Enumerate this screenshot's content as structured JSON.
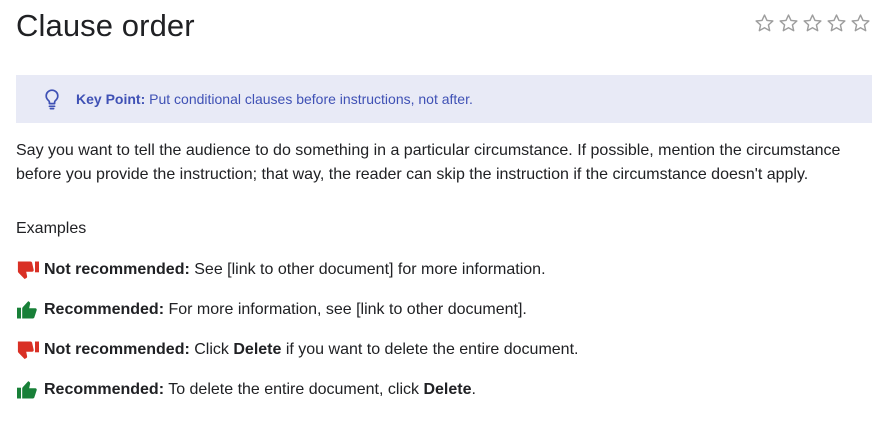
{
  "page": {
    "title": "Clause order"
  },
  "rating": {
    "stars": 5,
    "selected": 0,
    "star_icon": "star-outline-icon",
    "color": "#9e9e9e"
  },
  "callout": {
    "icon": "lightbulb-icon",
    "label": "Key Point:",
    "text": " Put conditional clauses before instructions, not after.",
    "background": "#e8eaf6",
    "text_color": "#3f51b5"
  },
  "body": {
    "paragraph": "Say you want to tell the audience to do something in a particular circumstance. If possible, mention the circumstance before you provide the instruction; that way, the reader can skip the instruction if the circumstance doesn't apply."
  },
  "examples": {
    "heading": "Examples",
    "items": [
      {
        "kind": "not-recommended",
        "icon": "thumbs-down-icon",
        "icon_color": "#d93025",
        "label": "Not recommended:",
        "text_before": " See [link to other document] for more information.",
        "strong": "",
        "text_after": ""
      },
      {
        "kind": "recommended",
        "icon": "thumbs-up-icon",
        "icon_color": "#188038",
        "label": "Recommended:",
        "text_before": " For more information, see [link to other document].",
        "strong": "",
        "text_after": ""
      },
      {
        "kind": "not-recommended",
        "icon": "thumbs-down-icon",
        "icon_color": "#d93025",
        "label": "Not recommended:",
        "text_before": " Click ",
        "strong": "Delete",
        "text_after": " if you want to delete the entire document."
      },
      {
        "kind": "recommended",
        "icon": "thumbs-up-icon",
        "icon_color": "#188038",
        "label": "Recommended:",
        "text_before": " To delete the entire document, click ",
        "strong": "Delete",
        "text_after": "."
      }
    ]
  }
}
